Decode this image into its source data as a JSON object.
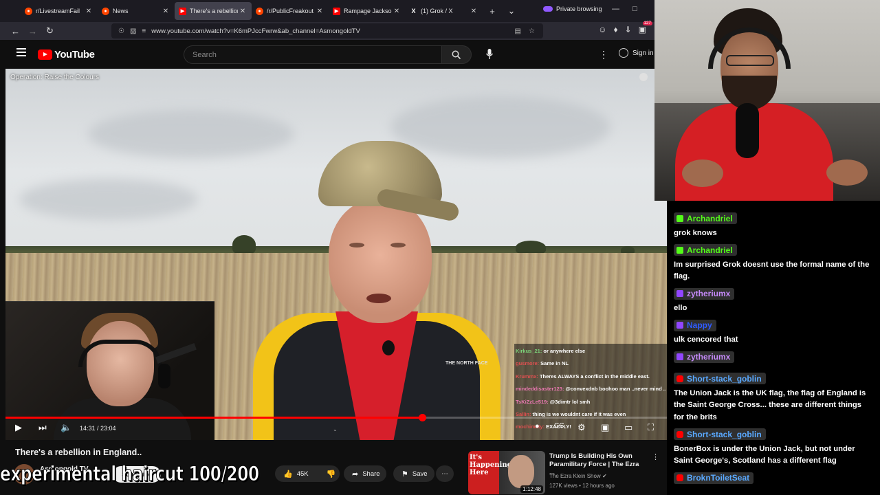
{
  "browser": {
    "tabs": [
      {
        "label": "r/LivestreamFail",
        "favicon": "reddit-icon",
        "active": false
      },
      {
        "label": "News",
        "favicon": "reddit-icon",
        "active": false
      },
      {
        "label": "There's a rebellion",
        "favicon": "youtube-icon",
        "active": true
      },
      {
        "label": "/r/PublicFreakout",
        "favicon": "reddit-icon",
        "active": false
      },
      {
        "label": "Rampage Jackson",
        "favicon": "youtube-icon",
        "active": false
      },
      {
        "label": "(1) Grok / X",
        "favicon": "x-icon",
        "active": false
      }
    ],
    "private_label": "Private browsing",
    "url": "www.youtube.com/watch?v=K6mPJccFwrw&ab_channel=AsmongoldTV",
    "extension_badge": "127"
  },
  "youtube": {
    "logo_text": "YouTube",
    "search_placeholder": "Search",
    "signin_label": "Sign in",
    "player": {
      "overlay_title": "Operation: Raise the Colours",
      "time": "14:31 / 23:04",
      "progress": 0.63
    },
    "video": {
      "title": "There's a rebellion in England..",
      "channel": "Asmongold TV",
      "subscribe": "Subscribe",
      "likes": "45K",
      "share": "Share",
      "save": "Save"
    },
    "recommended": {
      "thumb_text": "It's Happening Here",
      "duration": "1:12:48",
      "title": "Trump Is Building His Own Paramilitary Force | The Ezra ...",
      "channel": "The Ezra Klein Show",
      "meta": "127K views • 12 hours ago"
    }
  },
  "overlay_caption": "experimental haircut 100/200",
  "video_chat": [
    {
      "user": "Kirkus_21:",
      "text": "or anywhere else",
      "color": "#7cd37a"
    },
    {
      "user": "gusmore:",
      "text": "Same in NL",
      "color": "#e05050"
    },
    {
      "user": "Krummx:",
      "text": "Theres ALWAYS a conflict in the middle east.",
      "color": "#e05050"
    },
    {
      "user": "mindeddisaster123:",
      "text": "@convexdnb boohoo man ..never mind ..",
      "color": "#e878b0"
    },
    {
      "user": "TsKiZzLe519:",
      "text": "@3dimtr lol smh",
      "color": "#e878b0"
    },
    {
      "user": "Sallin:",
      "text": "thing is we wouldnt care if it was even",
      "color": "#e05050"
    },
    {
      "user": "mochimaty:",
      "text": "EXACTLY!",
      "color": "#e05050"
    }
  ],
  "chat": [
    {
      "user": "Archandriel",
      "platform": "kick",
      "name_color": "#53fc18",
      "text": "grok knows"
    },
    {
      "user": "Archandriel",
      "platform": "kick",
      "name_color": "#53fc18",
      "text": "Im surprised Grok doesnt use the formal name of the flag."
    },
    {
      "user": "zytheriumx",
      "platform": "twitch",
      "name_color": "#c58af9",
      "text": "ello"
    },
    {
      "user": "Nappy",
      "platform": "twitch",
      "name_color": "#2f5bff",
      "text": "ulk cencored that"
    },
    {
      "user": "zytheriumx",
      "platform": "twitch",
      "name_color": "#c58af9",
      "text": ""
    },
    {
      "user": "Short-stack_goblin",
      "platform": "youtube",
      "name_color": "#5aa9ff",
      "text": "The Union Jack is the UK flag, the flag of England is the Saint George Cross... these are different things for the brits"
    },
    {
      "user": "Short-stack_goblin",
      "platform": "youtube",
      "name_color": "#5aa9ff",
      "text": "BonerBox is under the Union Jack, but not under Saint George's, Scotland has a different flag"
    },
    {
      "user": "BroknToiletSeat",
      "platform": "youtube",
      "name_color": "#5aa9ff",
      "text": ""
    }
  ]
}
